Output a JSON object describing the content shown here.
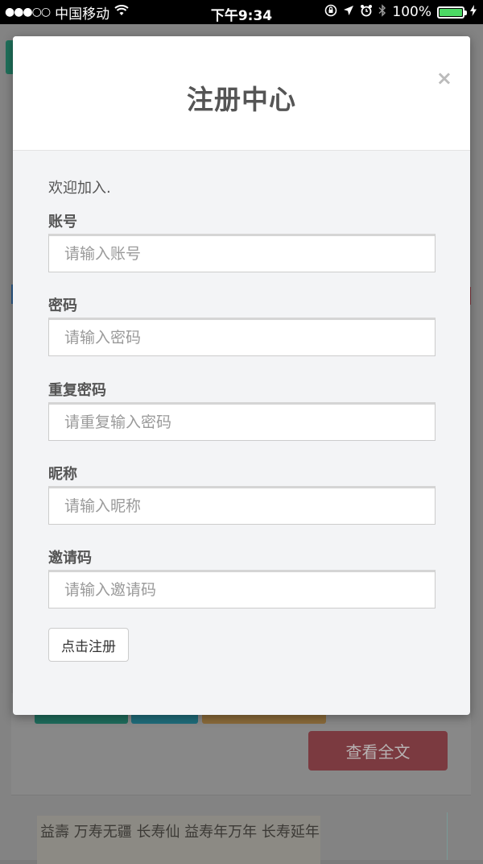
{
  "status_bar": {
    "signal_dots": "●●●○○",
    "carrier": "中国移动",
    "time": "下午9:34",
    "battery_percent": "100%",
    "battery_level": 1.0
  },
  "background": {
    "read_more_label": "查看全文",
    "image_caption": "益壽  万寿无疆 长寿仙 益寿年万年 长寿延年"
  },
  "modal": {
    "title": "注册中心",
    "close_symbol": "×",
    "welcome": "欢迎加入.",
    "fields": [
      {
        "label": "账号",
        "placeholder": "请输入账号"
      },
      {
        "label": "密码",
        "placeholder": "请输入密码"
      },
      {
        "label": "重复密码",
        "placeholder": "请重复输入密码"
      },
      {
        "label": "昵称",
        "placeholder": "请输入昵称"
      },
      {
        "label": "邀请码",
        "placeholder": "请输入邀请码"
      }
    ],
    "submit_label": "点击注册"
  },
  "colors": {
    "battery_green": "#4cd964",
    "modal_bg": "#f3f4f6",
    "overlay": "#7b7b7b"
  }
}
